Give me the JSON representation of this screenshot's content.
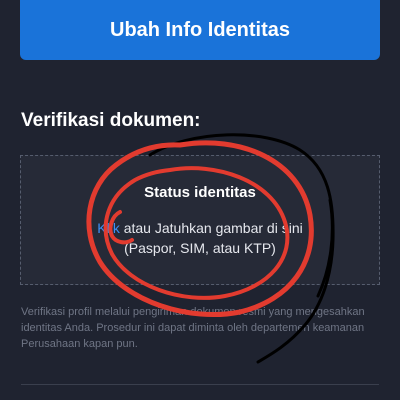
{
  "header": {
    "button_label": "Ubah Info Identitas"
  },
  "verification": {
    "section_title": "Verifikasi dokumen:",
    "dropzone": {
      "title": "Status identitas",
      "link_text": "Klik",
      "instruction_rest": " atau Jatuhkan gambar di sini",
      "accepted_types": "(Paspor, SIM, atau KTP)"
    },
    "info_text": "Verifikasi profil melalui pengiriman dokumen resmi yang mengesahkan identitas Anda. Prosedur ini dapat diminta oleh departemen keamanan Perusahaan kapan pun."
  },
  "annotation": {
    "color": "#e23b2f",
    "secondary_color": "#000000"
  }
}
